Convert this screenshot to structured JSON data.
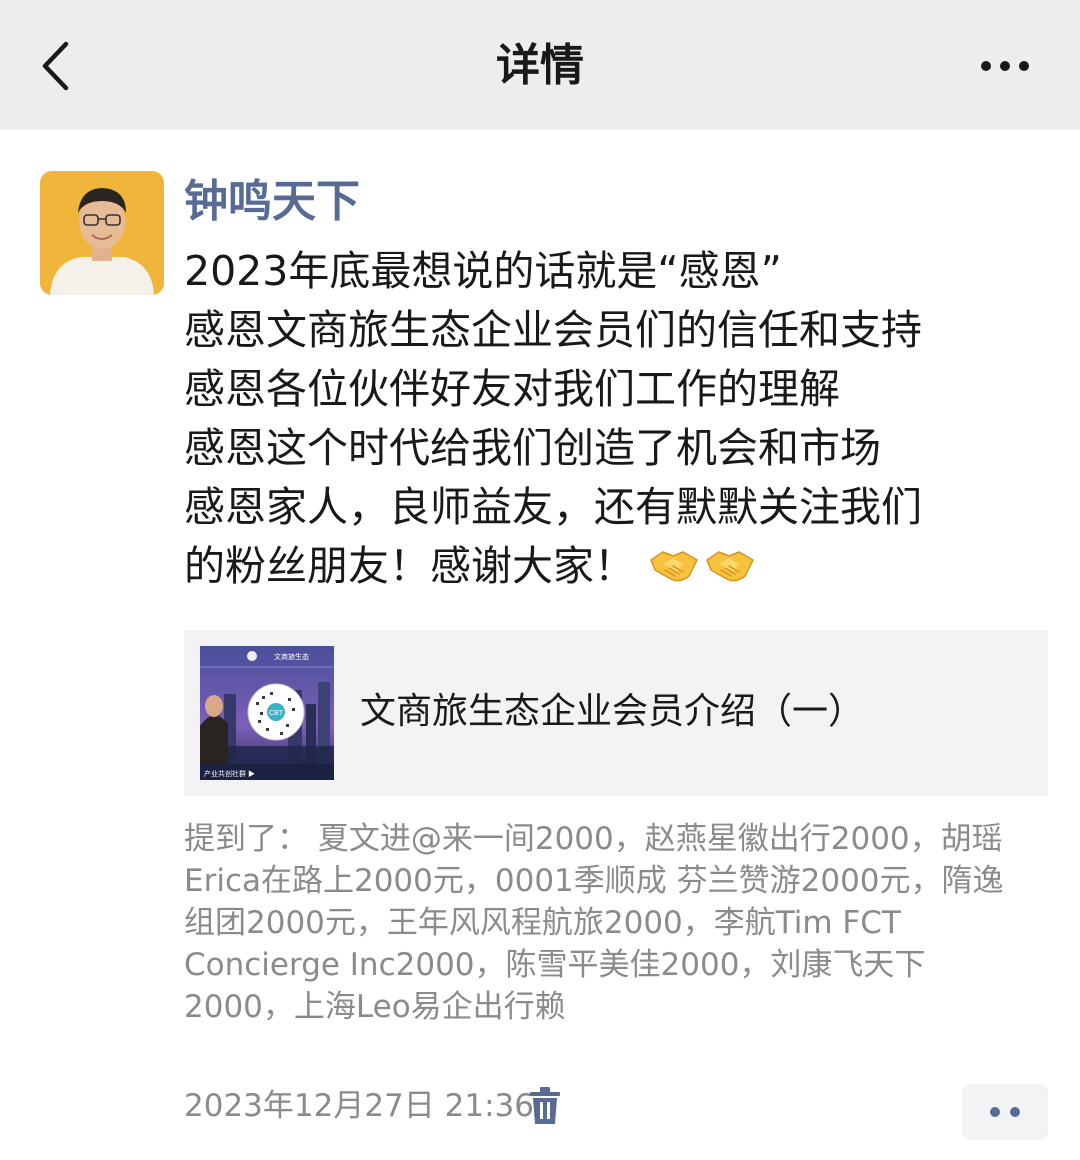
{
  "header": {
    "title": "详情",
    "back_icon": "chevron-left-icon",
    "more_icon": "more-horizontal-icon"
  },
  "post": {
    "author": "钟鸣天下",
    "lines": [
      "2023年底最想说的话就是“感恩”",
      "感恩文商旅生态企业会员们的信任和支持",
      "感恩各位伙伴好友对我们工作的理解",
      "感恩这个时代给我们创造了机会和市场",
      "感恩家人，良师益友，还有默默关注我们",
      "的粉丝朋友！感谢大家！"
    ],
    "emoji": "handshake-emoji x2"
  },
  "link_card": {
    "title": "文商旅生态企业会员介绍（一）",
    "thumb_header": "文商旅生态",
    "thumb_badge": "CBT",
    "thumb_footer": "产业共创社群 ▶"
  },
  "mentions": {
    "label": "提到了：",
    "text": "夏文进@来一间2000，赵燕星徽出行2000，胡瑶Erica在路上2000元，0001季顺成 芬兰赞游2000元，隋逸组团2000元，王年风风程航旅2000，李航Tim FCT Concierge Inc2000，陈雪平美佳2000，刘康飞天下2000，上海Leo易企出行赖"
  },
  "footer": {
    "timestamp": "2023年12月27日 21:36",
    "delete_icon": "trash-icon",
    "action_icon": "comment-like-icon"
  },
  "colors": {
    "topbar_bg": "#ededed",
    "name_blue": "#576b95",
    "meta_gray": "#8b8b8b",
    "card_bg": "#f3f3f5"
  }
}
